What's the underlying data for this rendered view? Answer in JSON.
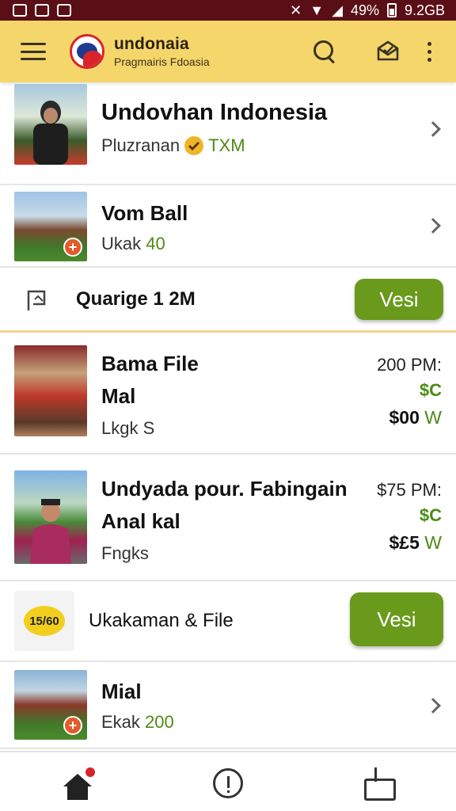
{
  "status_bar": {
    "battery": "49%",
    "network": "9.2GB"
  },
  "app_bar": {
    "title": "undonaia",
    "subtitle": "Pragmairis Fdoasia"
  },
  "rows": [
    {
      "title": "Undovhan Indonesia",
      "subtitle": "Pluzranan",
      "badge_text": "TXM"
    },
    {
      "title": "Vom Ball",
      "subtitle_prefix": "Ukak",
      "subtitle_value": "40"
    },
    {
      "title": "Quarige 1 2M",
      "button": "Vesi"
    },
    {
      "title_line1": "Bama File",
      "title_line2": "Mal",
      "subtitle": "Lkgk S",
      "price_top": "200 PM:",
      "price_mid": "$C",
      "price_bottom": "$00",
      "price_bottom_unit": "W"
    },
    {
      "title_line1": "Undyada pour. Fabingain",
      "title_line2": "Anal kal",
      "subtitle": "Fngks",
      "price_top": "$75 PM:",
      "price_mid": "$C",
      "price_bottom": "$£5",
      "price_bottom_unit": "W"
    },
    {
      "title": "Ukakaman & File",
      "button": "Vesi",
      "icon_text": "15/60"
    },
    {
      "title": "Mial",
      "subtitle_prefix": "Ekak",
      "subtitle_value": "200"
    }
  ],
  "colors": {
    "status_bar": "#5a0f16",
    "app_bar": "#f5d66a",
    "accent_green": "#6a9a1c",
    "badge_red": "#d8232a"
  },
  "icons": [
    "menu-icon",
    "search-icon",
    "mail-icon",
    "more-vert-icon",
    "home-icon",
    "info-icon",
    "inbox-download-icon"
  ]
}
